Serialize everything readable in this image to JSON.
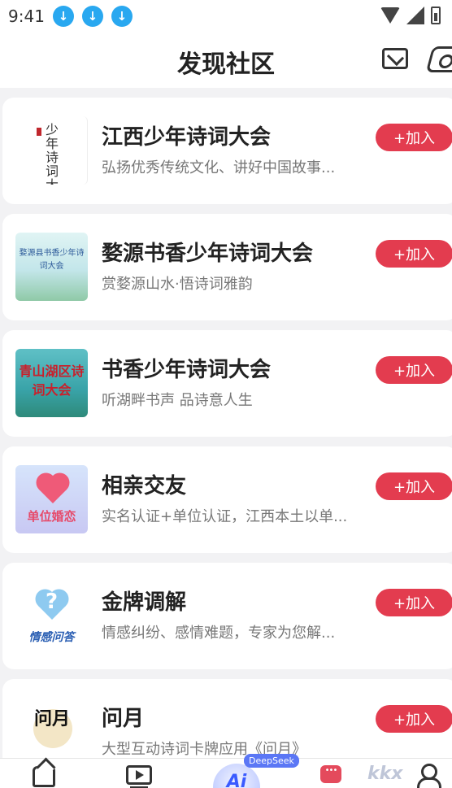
{
  "status_bar": {
    "time": "9:41",
    "download_icons": [
      "download-icon",
      "download-icon",
      "download-icon"
    ]
  },
  "header": {
    "title": "发现社区",
    "mail_icon": "mail-icon",
    "settings_icon": "settings-icon"
  },
  "communities": [
    {
      "title": "江西少年诗词大会",
      "desc": "弘扬优秀传统文化、讲好中国故事...",
      "join": "+加入",
      "thumb_text": "少年诗词大会"
    },
    {
      "title": "婺源书香少年诗词大会",
      "desc": "赏婺源山水·悟诗词雅韵",
      "join": "+加入",
      "thumb_text": "婺源县书香少年诗词大会"
    },
    {
      "title": "书香少年诗词大会",
      "desc": "听湖畔书声 品诗意人生",
      "join": "+加入",
      "thumb_text": "青山湖区诗词大会"
    },
    {
      "title": "相亲交友",
      "desc": "实名认证+单位认证，江西本土以单...",
      "join": "+加入",
      "thumb_text": "单位婚恋"
    },
    {
      "title": "金牌调解",
      "desc": "情感纠纷、感情难题，专家为您解...",
      "join": "+加入",
      "thumb_text": "情感问答"
    },
    {
      "title": "问月",
      "desc": "大型互动诗词卡牌应用《问月》",
      "join": "+加入",
      "thumb_text": "问月"
    }
  ],
  "tabbar": {
    "ai_label": "Ai",
    "deepseek_badge": "DeepSeek",
    "watermark": "kkx"
  }
}
